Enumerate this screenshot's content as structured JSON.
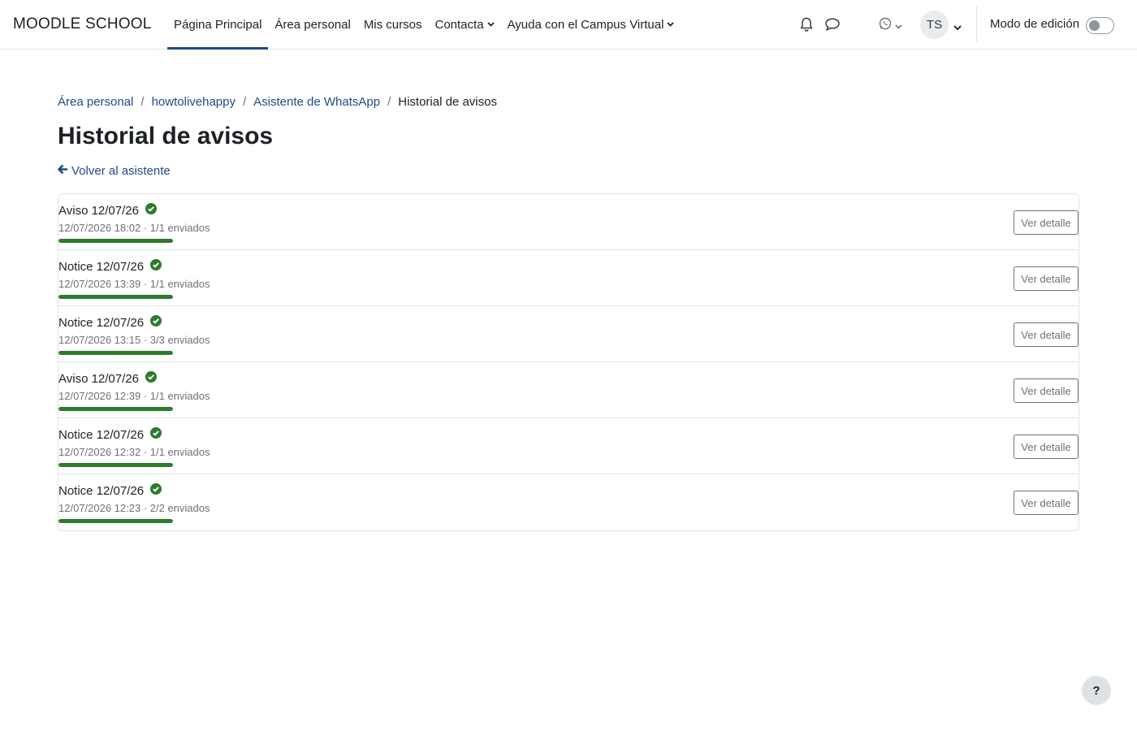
{
  "navbar": {
    "brand": "MOODLE SCHOOL",
    "items": [
      {
        "label": "Página Principal",
        "active": true,
        "dropdown": false
      },
      {
        "label": "Área personal",
        "active": false,
        "dropdown": false
      },
      {
        "label": "Mis cursos",
        "active": false,
        "dropdown": false
      },
      {
        "label": "Contacta",
        "active": false,
        "dropdown": true
      },
      {
        "label": "Ayuda con el Campus Virtual",
        "active": false,
        "dropdown": true
      }
    ],
    "icons": {
      "notifications": "bell-icon",
      "messages": "chat-bubble-icon",
      "whatsapp": "whatsapp-icon"
    },
    "user_initials": "TS",
    "edit_mode_label": "Modo de edición",
    "edit_mode_on": false
  },
  "breadcrumb": {
    "items": [
      "Área personal",
      "howtolivehappy",
      "Asistente de WhatsApp"
    ],
    "current": "Historial de avisos"
  },
  "page": {
    "title": "Historial de avisos",
    "back_label": "Volver al asistente"
  },
  "notices": [
    {
      "title": "Aviso 12/07/26",
      "meta": "12/07/2026 18:02 · 1/1 enviados",
      "status": "success",
      "progress": 1.0,
      "button": "Ver detalle"
    },
    {
      "title": "Notice 12/07/26",
      "meta": "12/07/2026 13:39 · 1/1 enviados",
      "status": "success",
      "progress": 1.0,
      "button": "Ver detalle"
    },
    {
      "title": "Notice 12/07/26",
      "meta": "12/07/2026 13:15 · 3/3 enviados",
      "status": "success",
      "progress": 1.0,
      "button": "Ver detalle"
    },
    {
      "title": "Aviso 12/07/26",
      "meta": "12/07/2026 12:39 · 1/1 enviados",
      "status": "success",
      "progress": 1.0,
      "button": "Ver detalle"
    },
    {
      "title": "Notice 12/07/26",
      "meta": "12/07/2026 12:32 · 1/1 enviados",
      "status": "success",
      "progress": 1.0,
      "button": "Ver detalle"
    },
    {
      "title": "Notice 12/07/26",
      "meta": "12/07/2026 12:23 · 2/2 enviados",
      "status": "success",
      "progress": 1.0,
      "button": "Ver detalle"
    }
  ],
  "colors": {
    "link": "#1f4a87",
    "success": "#2f7a2f",
    "muted": "#6a737b"
  },
  "help_label": "?"
}
